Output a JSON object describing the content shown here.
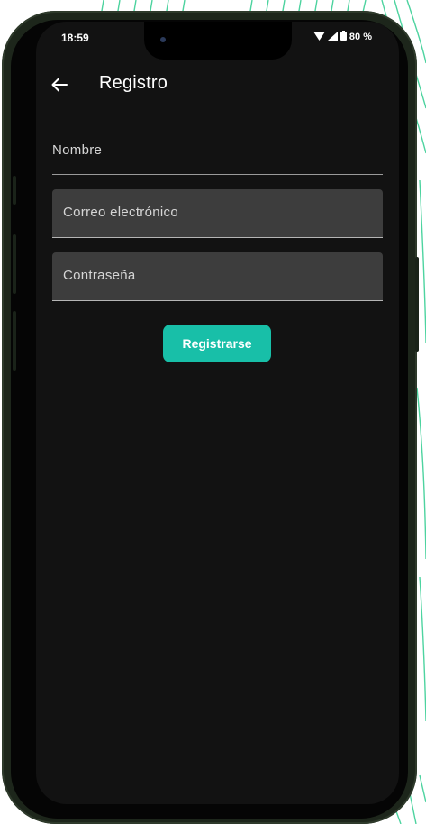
{
  "status_bar": {
    "time": "18:59",
    "battery_percent": "80 %",
    "icons": [
      "wifi-icon",
      "signal-icon",
      "battery-icon"
    ]
  },
  "app_bar": {
    "back_icon": "arrow-left-icon",
    "title": "Registro"
  },
  "form": {
    "name_label": "Nombre",
    "email_label": "Correo electrónico",
    "password_label": "Contraseña",
    "submit_label": "Registrarse"
  },
  "colors": {
    "accent": "#18bfa8",
    "screen_background": "#121212",
    "field_fill": "#3d3d3d",
    "phone_frame": "#1d261b",
    "decor_lines": "#2ecc8f"
  }
}
